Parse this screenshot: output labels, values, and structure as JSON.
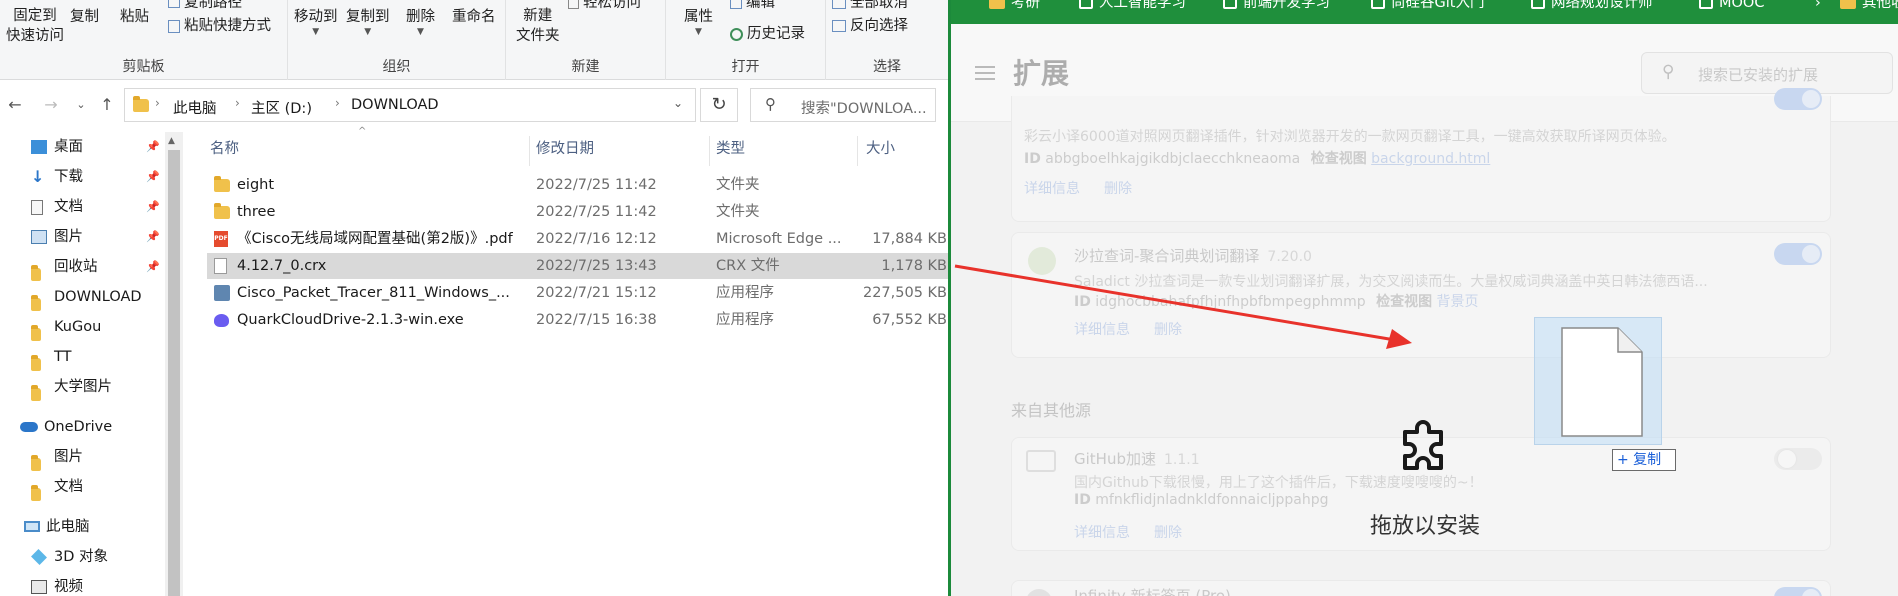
{
  "explorer": {
    "ribbon": {
      "clipboard": {
        "label": "剪贴板",
        "pin_line1": "固定到",
        "pin_line2": "快速访问",
        "copy": "复制",
        "paste": "粘贴",
        "copy_path": "复制路径",
        "paste_shortcut": "粘贴快捷方式"
      },
      "organize": {
        "label": "组织",
        "move_to": "移动到",
        "copy_to": "复制到",
        "delete": "删除",
        "rename": "重命名"
      },
      "new": {
        "label": "新建",
        "new_folder_line1": "新建",
        "new_folder_line2": "文件夹",
        "easy_access": "轻松访问"
      },
      "open": {
        "label": "打开",
        "properties": "属性",
        "edit": "编辑",
        "history": "历史记录"
      },
      "select": {
        "label": "选择",
        "select_all": "全部取消",
        "invert": "反向选择"
      }
    },
    "address": {
      "crumbs": [
        "此电脑",
        "主区 (D:)",
        "DOWNLOAD"
      ],
      "search_placeholder": "搜索\"DOWNLOA..."
    },
    "nav": [
      {
        "label": "桌面",
        "icon": "desktop-icon",
        "pinned": true
      },
      {
        "label": "下载",
        "icon": "download-arrow-icon",
        "pinned": true
      },
      {
        "label": "文档",
        "icon": "document-icon",
        "pinned": true
      },
      {
        "label": "图片",
        "icon": "picture-icon",
        "pinned": true
      },
      {
        "label": "回收站",
        "icon": "folder-icon",
        "pinned": true
      },
      {
        "label": "DOWNLOAD",
        "icon": "folder-icon",
        "pinned": false
      },
      {
        "label": "KuGou",
        "icon": "folder-icon",
        "pinned": false
      },
      {
        "label": "TT",
        "icon": "folder-icon",
        "pinned": false
      },
      {
        "label": "大学图片",
        "icon": "folder-icon",
        "pinned": false
      },
      {
        "label": "OneDrive",
        "icon": "cloud-icon",
        "pinned": false
      },
      {
        "label": "图片",
        "icon": "folder-icon",
        "pinned": false
      },
      {
        "label": "文档",
        "icon": "folder-icon",
        "pinned": false
      },
      {
        "label": "此电脑",
        "icon": "computer-icon",
        "pinned": false
      },
      {
        "label": "3D 对象",
        "icon": "cube-icon",
        "pinned": false
      },
      {
        "label": "视频",
        "icon": "video-icon",
        "pinned": false
      }
    ],
    "columns": {
      "name": "名称",
      "date": "修改日期",
      "type": "类型",
      "size": "大小"
    },
    "files": [
      {
        "name": "eight",
        "date": "2022/7/25 11:42",
        "type": "文件夹",
        "size": "",
        "icon": "folder-icon",
        "selected": false
      },
      {
        "name": "three",
        "date": "2022/7/25 11:42",
        "type": "文件夹",
        "size": "",
        "icon": "folder-icon",
        "selected": false
      },
      {
        "name": "《Cisco无线局域网配置基础(第2版)》.pdf",
        "date": "2022/7/16 12:12",
        "type": "Microsoft Edge ...",
        "size": "17,884 KB",
        "icon": "pdf-icon",
        "selected": false
      },
      {
        "name": "4.12.7_0.crx",
        "date": "2022/7/25 13:43",
        "type": "CRX 文件",
        "size": "1,178 KB",
        "icon": "file-icon",
        "selected": true
      },
      {
        "name": "Cisco_Packet_Tracer_811_Windows_...",
        "date": "2022/7/21 15:12",
        "type": "应用程序",
        "size": "227,505 KB",
        "icon": "exe-icon",
        "selected": false
      },
      {
        "name": "QuarkCloudDrive-2.1.3-win.exe",
        "date": "2022/7/15 16:38",
        "type": "应用程序",
        "size": "67,552 KB",
        "icon": "quark-icon",
        "selected": false
      }
    ]
  },
  "browser": {
    "bookmarks": [
      {
        "label": "考研",
        "icon": "folder-icon"
      },
      {
        "label": "人工智能学习",
        "icon": "ai-icon"
      },
      {
        "label": "前端开发学习",
        "icon": "code-icon"
      },
      {
        "label": "尚硅谷Git入门",
        "icon": "bili-icon"
      },
      {
        "label": "网络规划设计师",
        "icon": "bili-icon"
      },
      {
        "label": "MOOC",
        "icon": "bili-icon"
      },
      {
        "label": "其他收藏夹",
        "icon": "folder-icon"
      }
    ],
    "extensions_page": {
      "title": "扩展",
      "search_placeholder": "搜索已安装的扩展",
      "cards": [
        {
          "title": "",
          "version": "",
          "desc": "彩云小译6000道对照网页翻译插件，针对浏览器开发的一款网页翻译工具，一键高效获取所译网页体验。",
          "id_label": "ID",
          "id": "abbgboelhkajgikdbjclaecchkneaoma",
          "inspect_label": "检查视图",
          "inspect_link": "background.html",
          "details": "详细信息",
          "remove": "删除",
          "enabled": true
        },
        {
          "title": "沙拉查词-聚合词典划词翻译",
          "version": "7.20.0",
          "desc": "Saladict 沙拉查词是一款专业划词翻译扩展，为交叉阅读而生。大量权威词典涵盖中英日韩法德西语...",
          "id_label": "ID",
          "id": "idghocbbahafpfhjnfhpbfbmpegphmmp",
          "inspect_label": "检查视图",
          "inspect_link": "背景页",
          "details": "详细信息",
          "remove": "删除",
          "enabled": true
        },
        {
          "title": "GitHub加速",
          "version": "1.1.1",
          "desc": "国内Github下载很慢，用上了这个插件后，下载速度嗖嗖嗖的~！",
          "id_label": "ID",
          "id": "mfnkflidjnladnkldfonnaicljppahpg",
          "inspect_label": "",
          "inspect_link": "",
          "details": "详细信息",
          "remove": "删除",
          "enabled": false
        }
      ],
      "section_other": "来自其他源",
      "partial_card_title": "Infinity 新标签页 (Pro)",
      "drop_text": "拖放以安装",
      "drag_badge": "+ 复制"
    }
  },
  "colors": {
    "browser_accent": "#1f8f3c",
    "selection": "#d9d9d9",
    "folder": "#f0c14b",
    "arrow": "#e8322b"
  }
}
